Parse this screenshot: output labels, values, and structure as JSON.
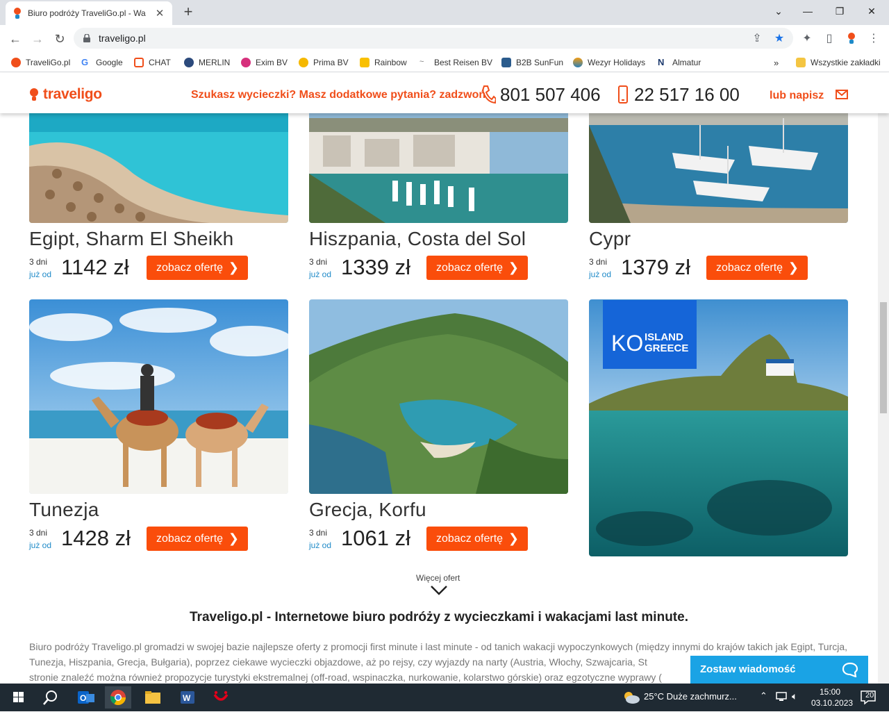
{
  "browser": {
    "tab_title": "Biuro podróży TraveliGo.pl - Wa",
    "url": "traveligo.pl",
    "bookmarks": [
      "TraveliGo.pl",
      "Google",
      "CHAT",
      "MERLIN",
      "Exim BV",
      "Prima BV",
      "Rainbow",
      "Best Reisen BV",
      "B2B SunFun",
      "Wezyr Holidays",
      "Almatur"
    ],
    "all_bookmarks": "Wszystkie zakładki"
  },
  "header": {
    "logo": "traveligo",
    "question": "Szukasz wycieczki? Masz dodatkowe pytania? zadzwoń",
    "phone1": "801 507 406",
    "phone2": "22 517 16 00",
    "write": "lub napisz"
  },
  "offers": [
    {
      "dest": "Egipt, Sharm El Sheikh",
      "days": "3 dni",
      "from": "już od",
      "price": "1142 zł",
      "button": "zobacz ofertę"
    },
    {
      "dest": "Hiszpania, Costa del Sol",
      "days": "3 dni",
      "from": "już od",
      "price": "1339 zł",
      "button": "zobacz ofertę"
    },
    {
      "dest": "Cypr",
      "days": "3 dni",
      "from": "już od",
      "price": "1379 zł",
      "button": "zobacz ofertę"
    },
    {
      "dest": "Tunezja",
      "days": "3 dni",
      "from": "już od",
      "price": "1428 zł",
      "button": "zobacz ofertę"
    },
    {
      "dest": "Grecja, Korfu",
      "days": "3 dni",
      "from": "już od",
      "price": "1061 zł",
      "button": "zobacz ofertę"
    }
  ],
  "banner": {
    "brand": "KO",
    "line1": "ISLAND",
    "line2": "GREECE"
  },
  "more_offers": "Więcej ofert",
  "section_title": "Traveligo.pl - Internetowe biuro podróży z wycieczkami i wakacjami last minute.",
  "section_text": "Biuro podróży Traveligo.pl gromadzi w swojej bazie najlepsze oferty z promocji first minute i last minute - od tanich wakacji wypoczynkowych (między innymi do krajów takich jak Egipt, Turcja, Tunezja, Hiszpania, Grecja, Bułgaria), poprzez ciekawe wycieczki objazdowe, aż po rejsy, czy wyjazdy na narty (Austria, Włochy, Szwajcaria, St",
  "section_text3": "stronie znaleźć można również propozycje turystyki ekstremalnej (off-road, wspinaczka, nurkowanie, kolarstwo górskie) oraz egzotyczne wyprawy (",
  "chat_widget": "Zostaw wiadomość",
  "taskbar": {
    "weather": "25°C  Duże zachmurz...",
    "time": "15:00",
    "date": "03.10.2023",
    "notifications": "20"
  }
}
